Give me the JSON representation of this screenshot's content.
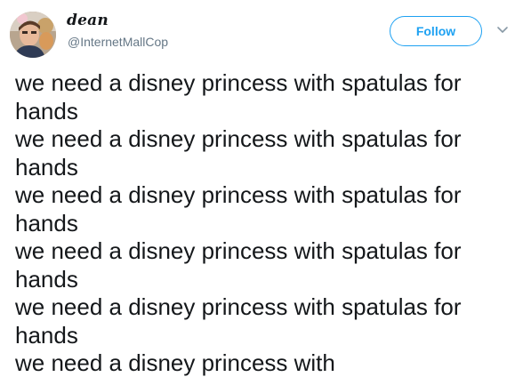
{
  "author": {
    "display_name": "dean",
    "handle": "@InternetMallCop",
    "avatar_icon": "avatar-photo"
  },
  "follow_button": {
    "label": "Follow",
    "color": "#1da1f2"
  },
  "menu": {
    "icon": "chevron-down-icon"
  },
  "tweet": {
    "lines": [
      "we need a disney princess with spatulas for",
      "hands",
      "we need a disney princess with spatulas for",
      "hands",
      "we need a disney princess with spatulas for",
      "hands",
      "we need a disney princess with spatulas for",
      "hands",
      "we need a disney princess with spatulas for",
      "hands",
      "we need a disney princess with"
    ]
  }
}
